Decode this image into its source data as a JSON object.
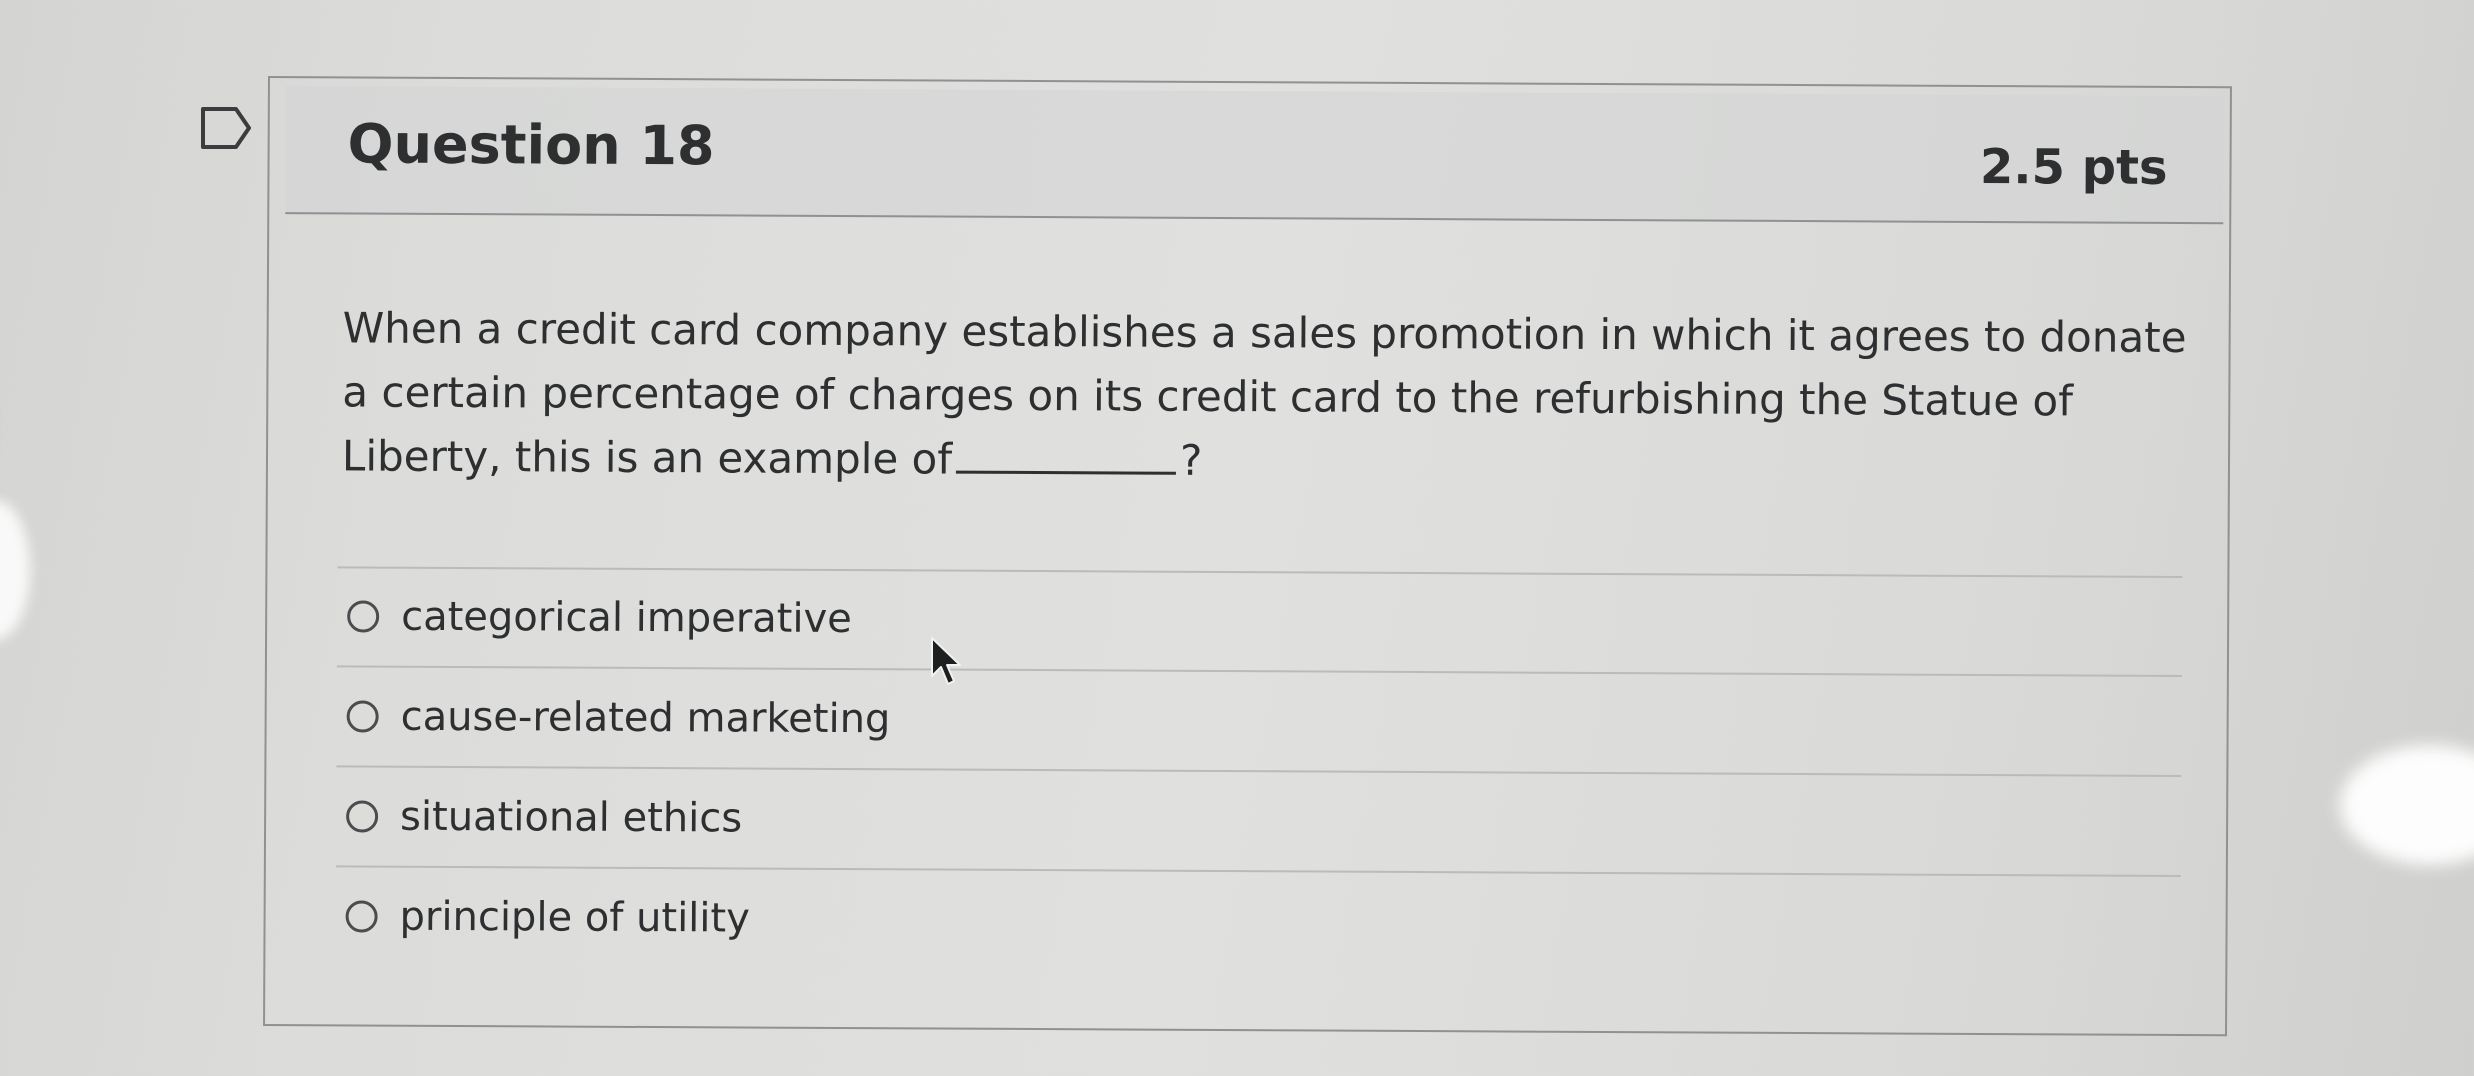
{
  "question": {
    "title": "Question 18",
    "points": "2.5 pts",
    "text_before_blank": "When a credit card company establishes a sales promotion in which it agrees to donate a certain percentage of charges on its credit card to the refurbishing the Statue of Liberty, this is an example of",
    "text_after_blank": "?"
  },
  "options": [
    {
      "label": "categorical imperative",
      "selected": false
    },
    {
      "label": "cause-related marketing",
      "selected": false
    },
    {
      "label": "situational ethics",
      "selected": false
    },
    {
      "label": "principle of utility",
      "selected": false
    }
  ],
  "icons": {
    "flag": "bookmark-flag-icon",
    "cursor": "mouse-pointer-icon"
  },
  "colors": {
    "text": "#2d2f31",
    "border": "#8f9193",
    "background": "#dcdcda"
  }
}
